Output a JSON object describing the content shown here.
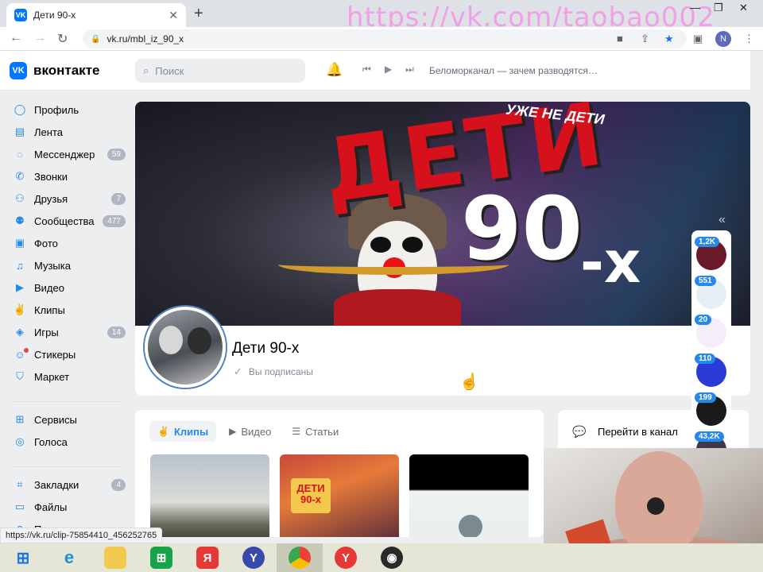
{
  "browser": {
    "tab_title": "Дети 90-х",
    "tab_close": "✕",
    "new_tab": "+",
    "watermark": "https://vk.com/taobao002",
    "url": "vk.ru/mbl_iz_90_x",
    "profile_initial": "N",
    "status_url": "https://vk.ru/clip-75854410_456252765"
  },
  "vk": {
    "logo_text": "вконтакте",
    "search_placeholder": "Поиск",
    "now_playing": "Беломорканал — зачем разводятся…"
  },
  "sidebar": {
    "items": [
      {
        "label": "Профиль",
        "icon": "user-circle-icon",
        "badge": ""
      },
      {
        "label": "Лента",
        "icon": "news-icon",
        "badge": ""
      },
      {
        "label": "Мессенджер",
        "icon": "message-icon",
        "badge": "59"
      },
      {
        "label": "Звонки",
        "icon": "phone-icon",
        "badge": ""
      },
      {
        "label": "Друзья",
        "icon": "friends-icon",
        "badge": "7"
      },
      {
        "label": "Сообщества",
        "icon": "community-icon",
        "badge": "477"
      },
      {
        "label": "Фото",
        "icon": "photo-icon",
        "badge": ""
      },
      {
        "label": "Музыка",
        "icon": "music-icon",
        "badge": ""
      },
      {
        "label": "Видео",
        "icon": "video-icon",
        "badge": ""
      },
      {
        "label": "Клипы",
        "icon": "clips-icon",
        "badge": ""
      },
      {
        "label": "Игры",
        "icon": "games-icon",
        "badge": "14"
      },
      {
        "label": "Стикеры",
        "icon": "sticker-icon",
        "badge": ""
      },
      {
        "label": "Маркет",
        "icon": "market-icon",
        "badge": ""
      },
      {
        "label": "Сервисы",
        "icon": "services-icon",
        "badge": ""
      },
      {
        "label": "Голоса",
        "icon": "coins-icon",
        "badge": ""
      },
      {
        "label": "Закладки",
        "icon": "bookmark-icon",
        "badge": "4"
      },
      {
        "label": "Файлы",
        "icon": "file-icon",
        "badge": ""
      },
      {
        "label": "Помощь",
        "icon": "help-icon",
        "badge": ""
      }
    ]
  },
  "cover": {
    "title_text": "ДЕТИ",
    "number_text": "90",
    "suffix_text": "-х",
    "slogan": "УЖЕ НЕ ДЕТИ"
  },
  "group": {
    "name": "Дети 90-х",
    "subscribed_label": "Вы подписаны"
  },
  "content_tabs": [
    {
      "label": "Клипы",
      "active": true
    },
    {
      "label": "Видео",
      "active": false
    },
    {
      "label": "Статьи",
      "active": false
    }
  ],
  "clip_thumb_text": "ДЕТИ 90-х",
  "right_panel": {
    "channel_link": "Перейти в канал"
  },
  "notifications": [
    {
      "count": "1,2K",
      "color": "#6b1a2a"
    },
    {
      "count": "551",
      "color": "#e8eef6"
    },
    {
      "count": "20",
      "color": "#f4eefa"
    },
    {
      "count": "110",
      "color": "#2a3ad6"
    },
    {
      "count": "199",
      "color": "#1a1a1a"
    },
    {
      "count": "43,2K",
      "color": "#3a3a4a"
    }
  ],
  "colors": {
    "vk_blue": "#0077ff",
    "link_blue": "#2688eb",
    "badge_gray": "#aeb7c2",
    "cover_red": "#d6111b"
  }
}
